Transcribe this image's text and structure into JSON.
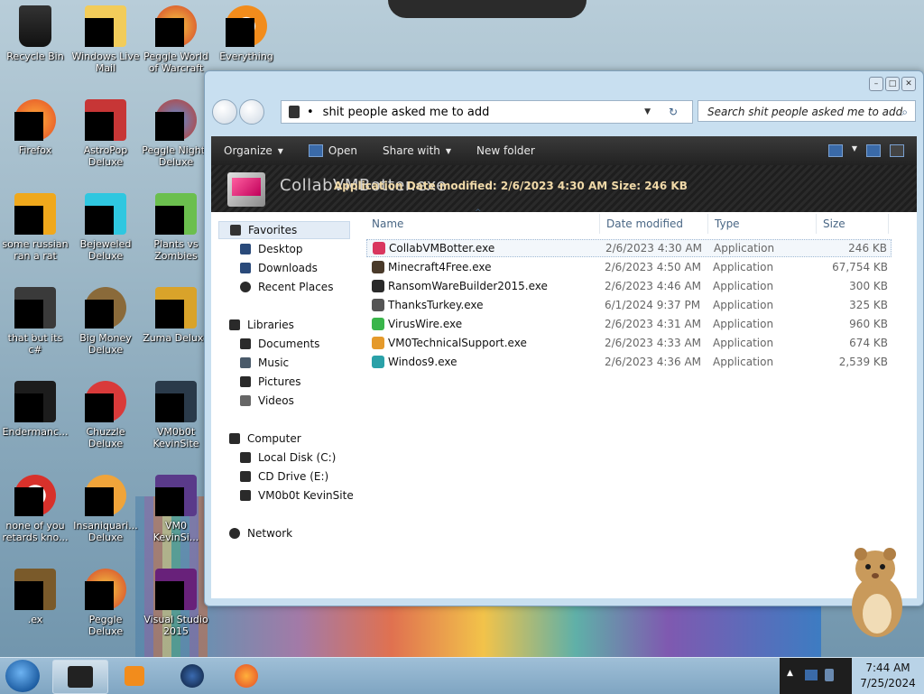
{
  "desktop": {
    "icons": [
      {
        "label": "Recycle Bin"
      },
      {
        "label": "Windows Live Mail"
      },
      {
        "label": "Peggle World of Warcraft"
      },
      {
        "label": "Everything"
      },
      {
        "label": "Firefox"
      },
      {
        "label": "AstroPop Deluxe"
      },
      {
        "label": "Peggle Nights Deluxe"
      },
      {
        "label": "some russian ran a rat"
      },
      {
        "label": "Bejeweled Deluxe"
      },
      {
        "label": "Plants vs Zombies"
      },
      {
        "label": "that but its c#"
      },
      {
        "label": "Big Money Deluxe"
      },
      {
        "label": "Zuma Deluxe"
      },
      {
        "label": "Endermanc..."
      },
      {
        "label": "Chuzzle Deluxe"
      },
      {
        "label": "VM0b0t KevinSite"
      },
      {
        "label": "none of you retards kno..."
      },
      {
        "label": "Insaniquari... Deluxe"
      },
      {
        "label": "VM0 KevinSi..."
      },
      {
        "label": ".ex"
      },
      {
        "label": "Peggle Deluxe"
      },
      {
        "label": "Visual Studio 2015"
      }
    ]
  },
  "window": {
    "address_path": "shit people asked me to add",
    "search_placeholder": "Search shit people asked me to add",
    "toolbar": {
      "organize": "Organize",
      "open": "Open",
      "share_with": "Share with",
      "new_folder": "New folder"
    },
    "preview": {
      "name": "CollabVMBotter.exe",
      "meta": "Application Date modified: 2/6/2023 4:30 AM Size: 246 KB"
    },
    "nav": {
      "favorites": "Favorites",
      "desktop": "Desktop",
      "downloads": "Downloads",
      "recent_places": "Recent Places",
      "libraries": "Libraries",
      "documents": "Documents",
      "music": "Music",
      "pictures": "Pictures",
      "videos": "Videos",
      "computer": "Computer",
      "local_disk": "Local Disk (C:)",
      "cd_drive": "CD Drive (E:)",
      "vm0b0t": "VM0b0t KevinSite",
      "network": "Network"
    },
    "columns": {
      "name": "Name",
      "date_modified": "Date modified",
      "type": "Type",
      "size": "Size"
    },
    "files": [
      {
        "name": "CollabVMBotter.exe",
        "date": "2/6/2023 4:30 AM",
        "type": "Application",
        "size": "246 KB",
        "color": "#d9365e"
      },
      {
        "name": "Minecraft4Free.exe",
        "date": "2/6/2023 4:50 AM",
        "type": "Application",
        "size": "67,754 KB",
        "color": "#4a3a2a"
      },
      {
        "name": "RansomWareBuilder2015.exe",
        "date": "2/6/2023 4:46 AM",
        "type": "Application",
        "size": "300 KB",
        "color": "#2a2a2a"
      },
      {
        "name": "ThanksTurkey.exe",
        "date": "6/1/2024 9:37 PM",
        "type": "Application",
        "size": "325 KB",
        "color": "#555555"
      },
      {
        "name": "VirusWire.exe",
        "date": "2/6/2023 4:31 AM",
        "type": "Application",
        "size": "960 KB",
        "color": "#39b54a"
      },
      {
        "name": "VM0TechnicalSupport.exe",
        "date": "2/6/2023 4:33 AM",
        "type": "Application",
        "size": "674 KB",
        "color": "#e59a2b"
      },
      {
        "name": "Windos9.exe",
        "date": "2/6/2023 4:36 AM",
        "type": "Application",
        "size": "2,539 KB",
        "color": "#2aa1a8"
      }
    ]
  },
  "taskbar": {
    "time": "7:44 AM",
    "date": "7/25/2024"
  }
}
